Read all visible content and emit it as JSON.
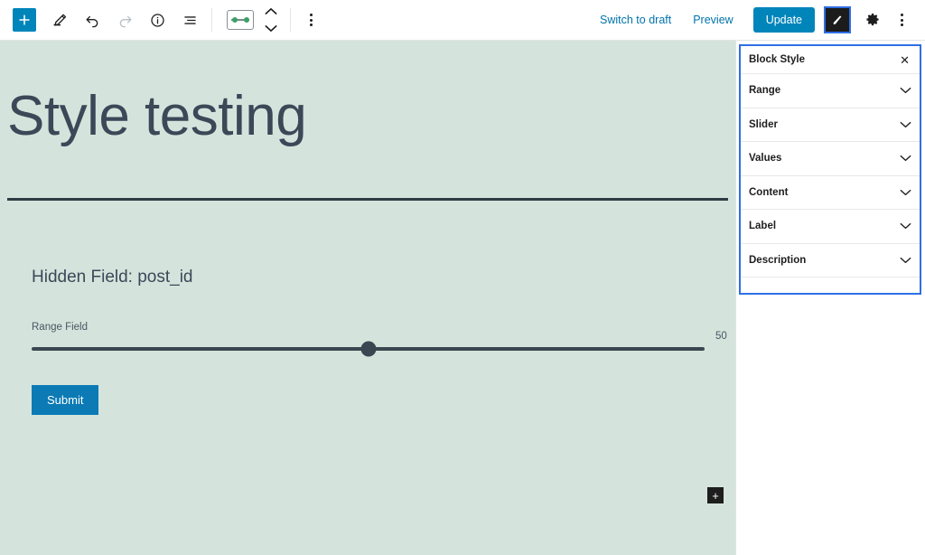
{
  "header": {
    "left_tools": [
      {
        "name": "add-block-button",
        "icon": "plus-icon",
        "label": "+"
      },
      {
        "name": "tools-pencil-button",
        "icon": "pencil-icon",
        "label": ""
      },
      {
        "name": "undo-button",
        "icon": "undo-icon",
        "label": ""
      },
      {
        "name": "redo-button",
        "icon": "redo-icon",
        "label": ""
      },
      {
        "name": "details-info-button",
        "icon": "info-icon",
        "label": ""
      },
      {
        "name": "list-view-button",
        "icon": "list-view-icon",
        "label": ""
      }
    ],
    "block_icon_name": "range-block-icon",
    "move_up_label": "",
    "move_down_label": "",
    "block_options_label": "",
    "switch_to_draft_label": "Switch to draft",
    "preview_label": "Preview",
    "update_label": "Update",
    "styles_icon_name": "brush-icon",
    "settings_icon_name": "gear-icon",
    "more_menu_icon_name": "kebab-menu-icon"
  },
  "canvas": {
    "post_title": "Style testing",
    "hidden_field_text": "Hidden Field: post_id",
    "range_label": "Range Field",
    "range_value": "50",
    "range_percent": 50,
    "submit_label": "Submit",
    "appender_label": "+",
    "background_color": "#d4e4dc"
  },
  "panel": {
    "title": "Block Style",
    "close_label": "✕",
    "sections": [
      {
        "label": "Range"
      },
      {
        "label": "Slider"
      },
      {
        "label": "Values"
      },
      {
        "label": "Content"
      },
      {
        "label": "Label"
      },
      {
        "label": "Description"
      }
    ],
    "accent_color": "#2f6fe4"
  }
}
